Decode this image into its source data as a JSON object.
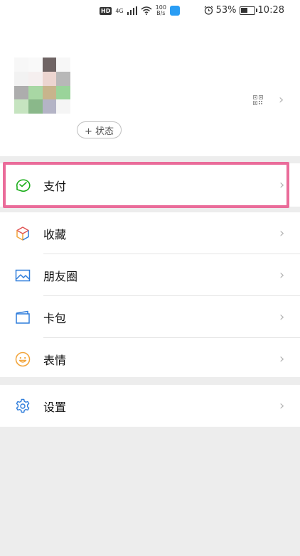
{
  "status_bar": {
    "hd": "HD",
    "network": "4G",
    "speed_value": "100",
    "speed_unit": "B/s",
    "battery": "53%",
    "time": "10:28"
  },
  "profile": {
    "status_button": "+ 状态"
  },
  "menu": {
    "pay": "支付",
    "favorites": "收藏",
    "moments": "朋友圈",
    "cards": "卡包",
    "stickers": "表情",
    "settings": "设置"
  },
  "colors": {
    "highlight": "#ea6c9a",
    "pay_icon": "#1aad19",
    "icon_blue": "#2f7ddb",
    "sticker_icon": "#f2a43a"
  },
  "battery_level": 0.53
}
